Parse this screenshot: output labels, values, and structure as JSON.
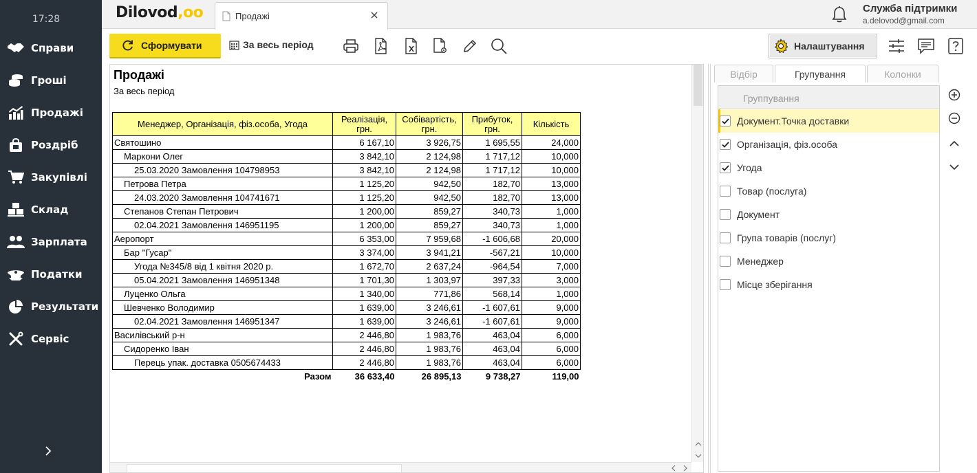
{
  "sidebar": {
    "time": "17:28",
    "items": [
      {
        "label": "Справи",
        "icon": "handshake-icon"
      },
      {
        "label": "Гроші",
        "icon": "coins-icon"
      },
      {
        "label": "Продажі",
        "icon": "sales-chart-icon"
      },
      {
        "label": "Роздріб",
        "icon": "shopping-bag-icon"
      },
      {
        "label": "Закупівлі",
        "icon": "cart-icon"
      },
      {
        "label": "Склад",
        "icon": "warehouse-boxes-icon"
      },
      {
        "label": "Зарплата",
        "icon": "people-icon"
      },
      {
        "label": "Податки",
        "icon": "officer-cap-icon"
      },
      {
        "label": "Результати",
        "icon": "pie-chart-icon"
      },
      {
        "label": "Сервіс",
        "icon": "tools-icon"
      }
    ]
  },
  "header": {
    "logo": "Dilovod",
    "logo_dots": ",oo",
    "tab_label": "Продажі",
    "support_title": "Служба підтримки",
    "support_email": "a.delovod@gmail.com"
  },
  "toolbar": {
    "generate_label": "Сформувати",
    "period_label": "За весь період",
    "settings_label": "Налаштування",
    "accent": "#f7dc1d"
  },
  "report": {
    "title": "Продажі",
    "subtitle": "За весь період",
    "columns": [
      "Менеджер, Організація, фіз.особа, Угода",
      "Реалізація, грн.",
      "Собівартість, грн.",
      "Прибуток, грн.",
      "Кількість"
    ],
    "rows": [
      {
        "level": 0,
        "name": "Святошино",
        "sales": "6 167,10",
        "cost": "3 926,75",
        "profit": "1 695,55",
        "qty": "24,000"
      },
      {
        "level": 1,
        "name": "Маркони Олег",
        "sales": "3 842,10",
        "cost": "2 124,98",
        "profit": "1 717,12",
        "qty": "10,000"
      },
      {
        "level": 2,
        "name": "25.03.2020 Замовлення 104798953",
        "sales": "3 842,10",
        "cost": "2 124,98",
        "profit": "1 717,12",
        "qty": "10,000"
      },
      {
        "level": 1,
        "name": "Петрова Петра",
        "sales": "1 125,20",
        "cost": "942,50",
        "profit": "182,70",
        "qty": "13,000"
      },
      {
        "level": 2,
        "name": "24.03.2020 Замовлення 104741671",
        "sales": "1 125,20",
        "cost": "942,50",
        "profit": "182,70",
        "qty": "13,000"
      },
      {
        "level": 1,
        "name": "Степанов Степан Петрович",
        "sales": "1 200,00",
        "cost": "859,27",
        "profit": "340,73",
        "qty": "1,000"
      },
      {
        "level": 2,
        "name": "02.04.2021 Замовлення 146951195",
        "sales": "1 200,00",
        "cost": "859,27",
        "profit": "340,73",
        "qty": "1,000"
      },
      {
        "level": 0,
        "name": "Аеропорт",
        "sales": "6 353,00",
        "cost": "7 959,68",
        "profit": "-1 606,68",
        "qty": "20,000"
      },
      {
        "level": 1,
        "name": "Бар \"Гусар\"",
        "sales": "3 374,00",
        "cost": "3 941,21",
        "profit": "-567,21",
        "qty": "10,000"
      },
      {
        "level": 2,
        "name": "Угода №345/8 від 1 квітня 2020 р.",
        "sales": "1 672,70",
        "cost": "2 637,24",
        "profit": "-964,54",
        "qty": "7,000"
      },
      {
        "level": 2,
        "name": "05.04.2021 Замовлення 146951348",
        "sales": "1 701,30",
        "cost": "1 303,97",
        "profit": "397,33",
        "qty": "3,000"
      },
      {
        "level": 1,
        "name": "Луценко Ольга",
        "sales": "1 340,00",
        "cost": "771,86",
        "profit": "568,14",
        "qty": "1,000"
      },
      {
        "level": 1,
        "name": "Шевченко Володимир",
        "sales": "1 639,00",
        "cost": "3 246,61",
        "profit": "-1 607,61",
        "qty": "9,000"
      },
      {
        "level": 2,
        "name": "02.04.2021 Замовлення 146951347",
        "sales": "1 639,00",
        "cost": "3 246,61",
        "profit": "-1 607,61",
        "qty": "9,000"
      },
      {
        "level": 0,
        "name": "Василівський р-н",
        "sales": "2 446,80",
        "cost": "1 983,76",
        "profit": "463,04",
        "qty": "6,000"
      },
      {
        "level": 1,
        "name": "Сидоренко Іван",
        "sales": "2 446,80",
        "cost": "1 983,76",
        "profit": "463,04",
        "qty": "6,000"
      },
      {
        "level": 2,
        "name": "Перець упак. доставка 0505674433",
        "sales": "2 446,80",
        "cost": "1 983,76",
        "profit": "463,04",
        "qty": "6,000"
      }
    ],
    "total": {
      "label": "Разом",
      "sales": "36 633,40",
      "cost": "26 895,13",
      "profit": "9 738,27",
      "qty": "119,00"
    },
    "header_color": "#ffff99"
  },
  "panel": {
    "tabs": [
      "Відбір",
      "Групування",
      "Колонки"
    ],
    "active_tab": 1,
    "header_label": "Группування",
    "items": [
      {
        "label": "Документ.Точка доставки",
        "checked": true,
        "selected": true
      },
      {
        "label": "Організація, фіз.особа",
        "checked": true,
        "selected": false
      },
      {
        "label": "Угода",
        "checked": true,
        "selected": false
      },
      {
        "label": "Товар (послуга)",
        "checked": false,
        "selected": false
      },
      {
        "label": "Документ",
        "checked": false,
        "selected": false
      },
      {
        "label": "Група товарів (послуг)",
        "checked": false,
        "selected": false
      },
      {
        "label": "Менеджер",
        "checked": false,
        "selected": false
      },
      {
        "label": "Місце зберігання",
        "checked": false,
        "selected": false
      }
    ]
  }
}
